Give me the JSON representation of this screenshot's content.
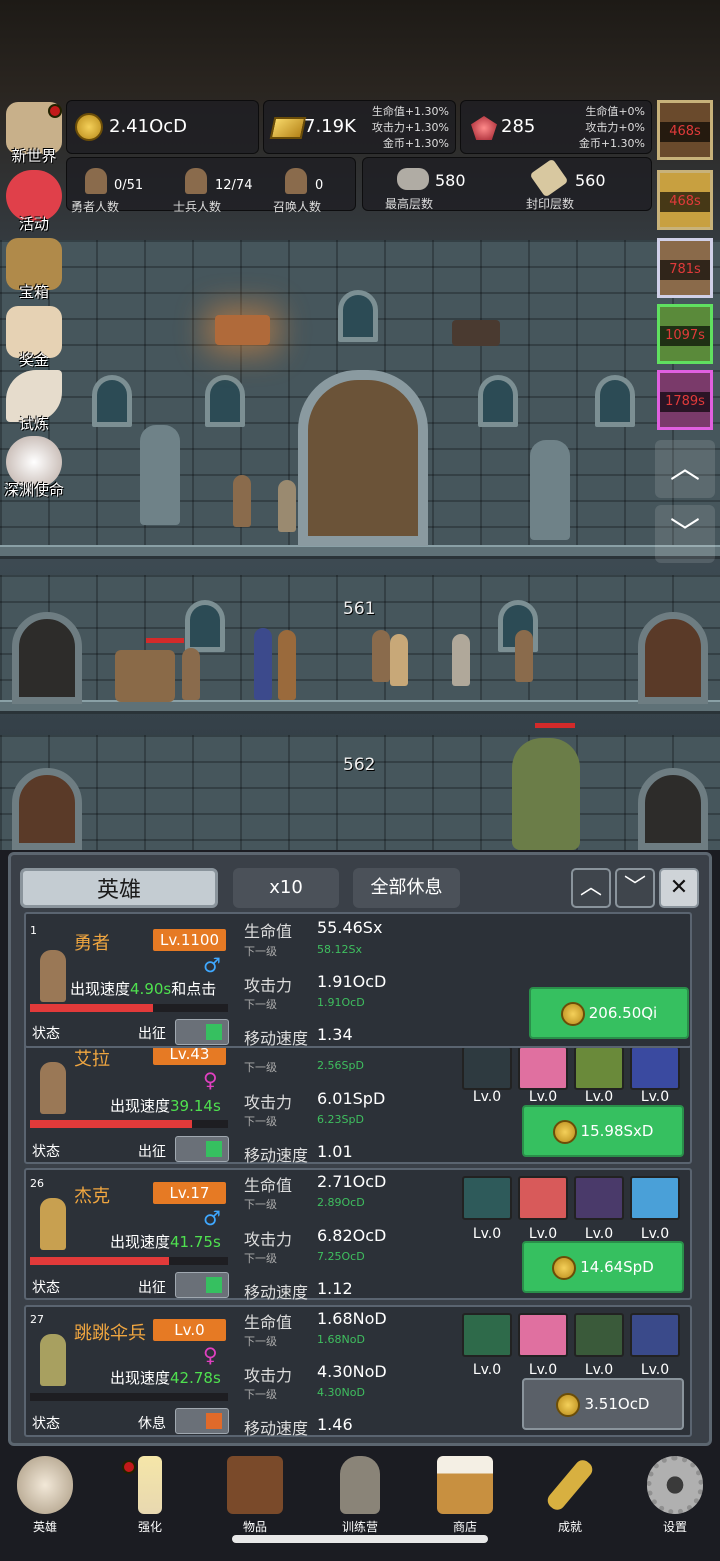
{
  "resources": {
    "coins": "2.41OcD",
    "gold": "7.19K",
    "gold_bonus": [
      "生命值+1.30%",
      "攻击力+1.30%",
      "金币+1.30%"
    ],
    "gems": "285",
    "gem_bonus": [
      "生命值+0%",
      "攻击力+0%",
      "金币+1.30%"
    ]
  },
  "counts": {
    "heroes": {
      "value": "0/51",
      "label": "勇者人数"
    },
    "soldiers": {
      "value": "12/74",
      "label": "士兵人数"
    },
    "summons": {
      "value": "0",
      "label": "召唤人数"
    },
    "max_floor": {
      "value": "580",
      "label": "最高层数"
    },
    "sealed_floor": {
      "value": "560",
      "label": "封印层数"
    }
  },
  "left_menu": [
    {
      "label": "新世界",
      "icon": "castle-icon"
    },
    {
      "label": "活动",
      "icon": "heart-icon"
    },
    {
      "label": "宝箱",
      "icon": "chest-icon"
    },
    {
      "label": "奖金",
      "icon": "envelope-icon"
    },
    {
      "label": "试炼",
      "icon": "feather-icon"
    },
    {
      "label": "深渊使命",
      "icon": "pearl-icon"
    }
  ],
  "boss_timers": [
    "468s",
    "468s",
    "781s",
    "1097s",
    "1789s"
  ],
  "floors": {
    "upper": "561",
    "lower": "562"
  },
  "panel": {
    "tab_title": "英雄",
    "multiplier": "x10",
    "rest_all": "全部休息",
    "heroes": [
      {
        "index": "1",
        "name": "勇者",
        "level": "Lv.1100",
        "gender": "♂",
        "speed_prefix": "出现速度",
        "speed": "4.90s",
        "speed_suffix": "和点击",
        "hp_label": "生命值",
        "hp": "55.46Sx",
        "next_label": "下一级",
        "hp_next": "58.12Sx",
        "atk_label": "攻击力",
        "atk": "1.91OcD",
        "atk_next": "1.91OcD",
        "move_label": "移动速度",
        "move": "1.34",
        "status_label": "状态",
        "status": "出征",
        "cost": "206.50Qi",
        "hp_ratio": 0.62
      },
      {
        "index": "",
        "name": "艾拉",
        "level": "Lv.43",
        "gender": "♀",
        "speed_prefix": "出现速度",
        "speed": "39.14s",
        "hp_next": "2.56SpD",
        "next_label": "下一级",
        "atk_label": "攻击力",
        "atk": "6.01SpD",
        "atk_next": "6.23SpD",
        "move_label": "移动速度",
        "move": "1.01",
        "status_label": "状态",
        "status": "出征",
        "cost": "15.98SxD",
        "hp_ratio": 0.82,
        "skills": [
          "Lv.0",
          "Lv.0",
          "Lv.0",
          "Lv.0"
        ]
      },
      {
        "index": "26",
        "name": "杰克",
        "level": "Lv.17",
        "gender": "♂",
        "speed_prefix": "出现速度",
        "speed": "41.75s",
        "hp_label": "生命值",
        "hp": "2.71OcD",
        "next_label": "下一级",
        "hp_next": "2.89OcD",
        "atk_label": "攻击力",
        "atk": "6.82OcD",
        "atk_next": "7.25OcD",
        "move_label": "移动速度",
        "move": "1.12",
        "status_label": "状态",
        "status": "出征",
        "cost": "14.64SpD",
        "hp_ratio": 0.7,
        "skills": [
          "Lv.0",
          "Lv.0",
          "Lv.0",
          "Lv.0"
        ]
      },
      {
        "index": "27",
        "name": "跳跳伞兵",
        "level": "Lv.0",
        "gender": "♀",
        "speed_prefix": "出现速度",
        "speed": "42.78s",
        "hp_label": "生命值",
        "hp": "1.68NoD",
        "next_label": "下一级",
        "hp_next": "1.68NoD",
        "atk_label": "攻击力",
        "atk": "4.30NoD",
        "atk_next": "4.30NoD",
        "move_label": "移动速度",
        "move": "1.46",
        "status_label": "状态",
        "status": "休息",
        "cost": "3.51OcD",
        "hp_ratio": 0,
        "skills": [
          "Lv.0",
          "Lv.0",
          "Lv.0",
          "Lv.0"
        ]
      }
    ]
  },
  "nav": [
    {
      "label": "英雄",
      "icon": "skull-icon"
    },
    {
      "label": "强化",
      "icon": "candle-icon"
    },
    {
      "label": "物品",
      "icon": "book-icon"
    },
    {
      "label": "训练营",
      "icon": "lantern-icon"
    },
    {
      "label": "商店",
      "icon": "beer-mug-icon"
    },
    {
      "label": "成就",
      "icon": "key-icon"
    },
    {
      "label": "设置",
      "icon": "gear-icon"
    }
  ],
  "colors": {
    "accent_green": "#36c060",
    "level_orange": "#e67a24",
    "timer_red": "#e03a3a"
  }
}
